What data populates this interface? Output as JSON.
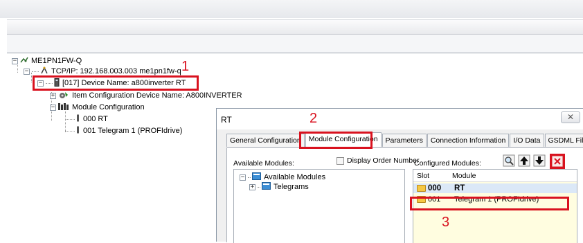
{
  "tree": {
    "root": "ME1PN1FW-Q",
    "tcp": "TCP/IP: 192.168.003.003  me1pn1fw-q",
    "device": "[017] Device Name: a800inverter  RT",
    "item_config": "Item Configuration  Device Name: A800INVERTER",
    "module_config": "Module Configuration",
    "module_rt": "000 RT",
    "module_telegram": "001 Telegram 1 (PROFIdrive)"
  },
  "annotations": [
    "1",
    "2",
    "3"
  ],
  "dialog": {
    "title": "RT",
    "close": "✕",
    "tabs": [
      "General Configuration",
      "Module Configuration",
      "Parameters",
      "Connection Information",
      "I/O Data",
      "GSDML File"
    ],
    "available_modules_label": "Available Modules:",
    "display_order_label": "Display Order Number",
    "configured_modules_label": "Configured Modules:",
    "available_tree": {
      "root": "Available Modules",
      "child": "Telegrams"
    },
    "grid": {
      "headers": [
        "Slot",
        "Module"
      ],
      "rows": [
        {
          "slot": "000",
          "module": "RT"
        },
        {
          "slot": "001",
          "module": "Telegram 1 (PROFIdrive)"
        }
      ]
    }
  },
  "colors": {
    "annotation_red": "#d9121f",
    "row_highlight": "#fffde0",
    "selected_row": "#dbe8f7"
  },
  "icons": [
    "network-icon",
    "tcp-icon",
    "device-icon",
    "item-config-icon",
    "module-config-icon",
    "module-icon",
    "search-icon",
    "arrow-up-icon",
    "arrow-down-icon",
    "delete-icon",
    "folder-icon"
  ]
}
